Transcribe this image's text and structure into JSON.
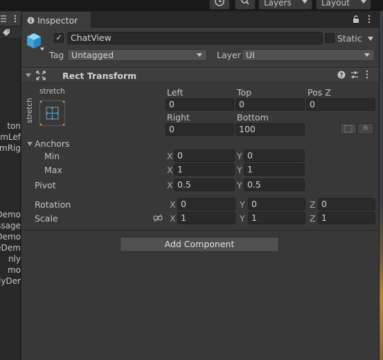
{
  "toolbar": {
    "layers_label": "Layers",
    "layout_label": "Layout",
    "history_icon": "history-icon",
    "search_icon": "search-icon"
  },
  "hierarchy": {
    "items": [
      "ton",
      "omLef",
      "omRig",
      "Demo",
      "ssage",
      "Demo",
      "eDem",
      "nly",
      "mo",
      "lyDer"
    ]
  },
  "inspector": {
    "tab_label": "Inspector",
    "lock_icon": "lock-icon",
    "menu_icon": "kebab-menu-icon"
  },
  "gameobject": {
    "active": true,
    "name": "ChatView",
    "static_label": "Static",
    "static_checked": false,
    "tag_label": "Tag",
    "tag_value": "Untagged",
    "layer_label": "Layer",
    "layer_value": "UI"
  },
  "rect_transform": {
    "title": "Rect Transform",
    "anchor_preset": "stretch",
    "anchor_preset_vertical": "stretch",
    "left_label": "Left",
    "left_value": "0",
    "top_label": "Top",
    "top_value": "0",
    "posz_label": "Pos Z",
    "posz_value": "0",
    "right_label": "Right",
    "right_value": "0",
    "bottom_label": "Bottom",
    "bottom_value": "100",
    "raw_edit_label": "R",
    "anchors_label": "Anchors",
    "min_label": "Min",
    "min_x": "0",
    "min_y": "0",
    "max_label": "Max",
    "max_x": "1",
    "max_y": "1",
    "pivot_label": "Pivot",
    "pivot_x": "0.5",
    "pivot_y": "0.5",
    "rotation_label": "Rotation",
    "rot_x": "0",
    "rot_y": "0",
    "rot_z": "0",
    "scale_label": "Scale",
    "scale_x": "1",
    "scale_y": "1",
    "scale_z": "1",
    "axis_x": "X",
    "axis_y": "Y",
    "axis_z": "Z"
  },
  "add_component_label": "Add Component",
  "colors": {
    "panel_bg": "#383838",
    "field_bg": "#2a2a2a",
    "accent": "#3a9ad9"
  }
}
